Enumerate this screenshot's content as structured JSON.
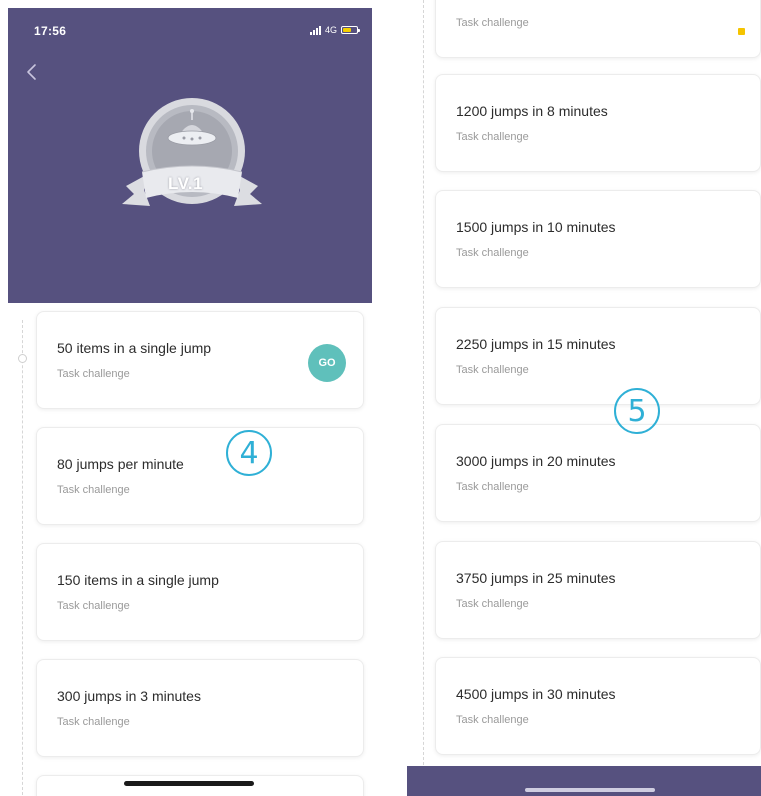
{
  "left_screen": {
    "status_bar": {
      "time": "17:56",
      "network": "4G",
      "battery_color": "#f5d000"
    },
    "header": {
      "background": "#56517f",
      "level_badge": "LV.1"
    },
    "tasks": [
      {
        "title": "50 items in a single jump",
        "subtitle": "Task challenge",
        "action": "GO"
      },
      {
        "title": "80 jumps per minute",
        "subtitle": "Task challenge"
      },
      {
        "title": "150 items in a single jump",
        "subtitle": "Task challenge"
      },
      {
        "title": "300 jumps in 3 minutes",
        "subtitle": "Task challenge"
      }
    ],
    "annotation": "4"
  },
  "right_screen": {
    "tasks": [
      {
        "title": "",
        "subtitle": "Task challenge"
      },
      {
        "title": "1200 jumps in 8 minutes",
        "subtitle": "Task challenge"
      },
      {
        "title": "1500 jumps in 10 minutes",
        "subtitle": "Task challenge"
      },
      {
        "title": "2250 jumps in 15 minutes",
        "subtitle": "Task challenge"
      },
      {
        "title": "3000 jumps in 20 minutes",
        "subtitle": "Task challenge"
      },
      {
        "title": "3750 jumps in 25 minutes",
        "subtitle": "Task challenge"
      },
      {
        "title": "4500 jumps in 30 minutes",
        "subtitle": "Task challenge"
      }
    ],
    "annotation": "5"
  },
  "colors": {
    "accent_purple": "#56517f",
    "go_button": "#5fc0bb",
    "annotation": "#2fb0d6"
  }
}
